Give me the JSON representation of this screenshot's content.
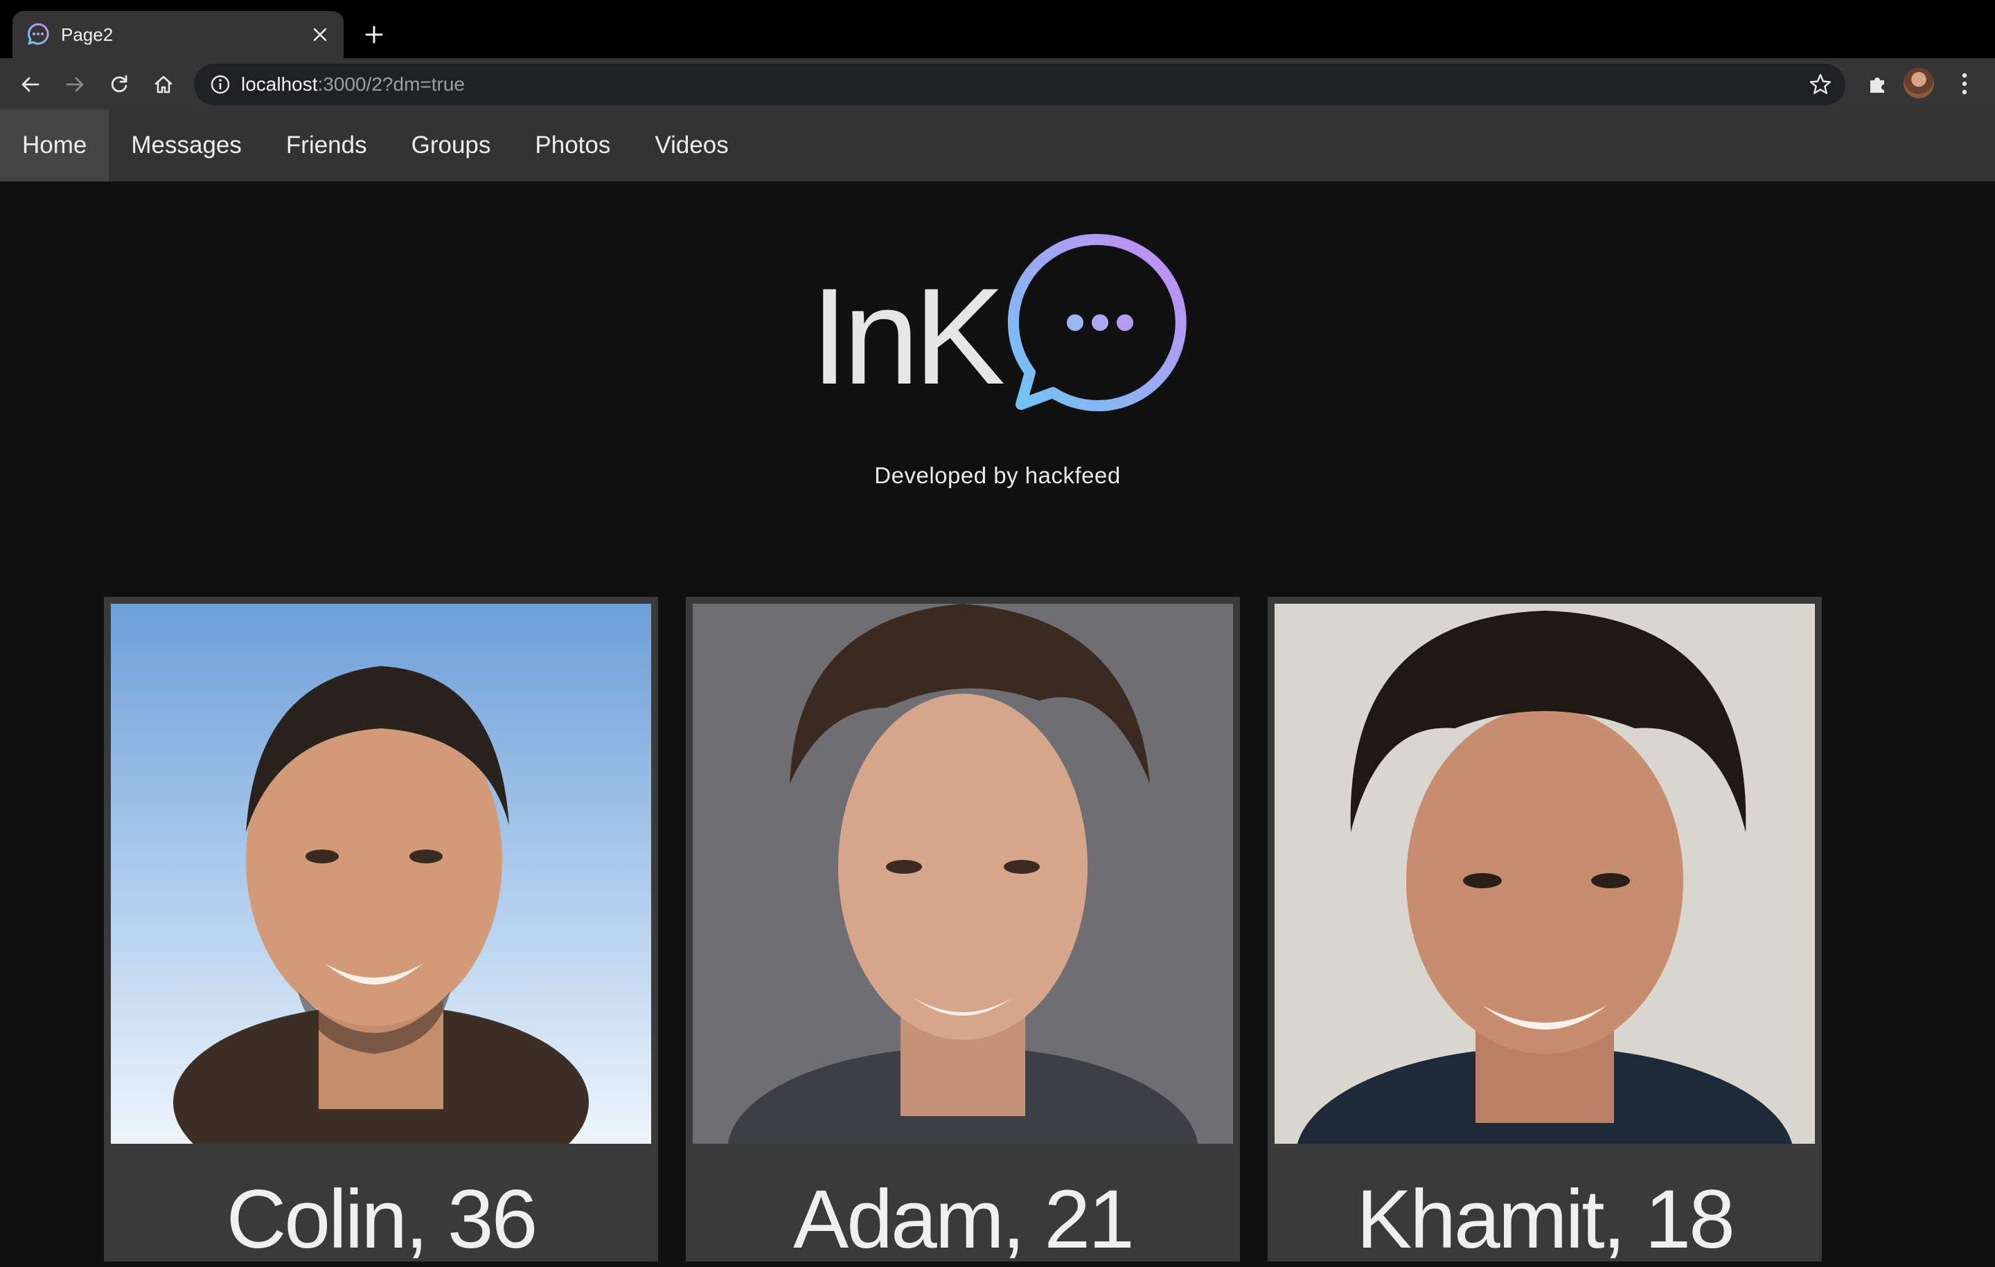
{
  "browser": {
    "tab": {
      "title": "Page2"
    },
    "url": {
      "host": "localhost",
      "rest": ":3000/2?dm=true"
    }
  },
  "nav": {
    "items": [
      {
        "label": "Home",
        "active": true
      },
      {
        "label": "Messages",
        "active": false
      },
      {
        "label": "Friends",
        "active": false
      },
      {
        "label": "Groups",
        "active": false
      },
      {
        "label": "Photos",
        "active": false
      },
      {
        "label": "Videos",
        "active": false
      }
    ]
  },
  "brand": {
    "name": "InK",
    "logo_icon": "chat-bubble-icon",
    "tagline": "Developed by hackfeed"
  },
  "profiles": [
    {
      "name_age": "Colin, 36"
    },
    {
      "name_age": "Adam, 21"
    },
    {
      "name_age": "Khamit, 18"
    }
  ],
  "colors": {
    "background": "#111111",
    "nav_bar": "#333333",
    "nav_active": "#444444",
    "card": "#3a3a3a",
    "logo_gradient_start": "#6ec6f5",
    "logo_gradient_end": "#c98af3"
  }
}
